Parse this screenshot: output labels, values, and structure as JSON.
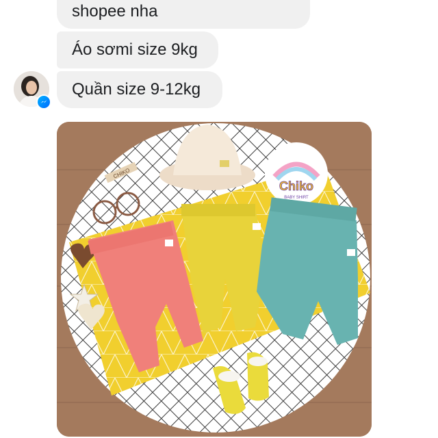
{
  "messages": [
    {
      "text": "shopee nha"
    },
    {
      "text": "Áo sơmi size 9kg"
    },
    {
      "text": "Quần size 9-12kg"
    }
  ],
  "photo": {
    "hat_label": "CHIKO",
    "brand_name": "Chiko",
    "brand_tagline": "BABY SHIRT",
    "pants_colors": [
      "#f0807a",
      "#e8d33a",
      "#68b3b0"
    ],
    "mat_color": "#f1cf2e"
  },
  "colors": {
    "bubble_bg": "#f0f0f0",
    "messenger_blue": "#0a7cff"
  },
  "icons": [
    "messenger-icon",
    "avatar"
  ]
}
